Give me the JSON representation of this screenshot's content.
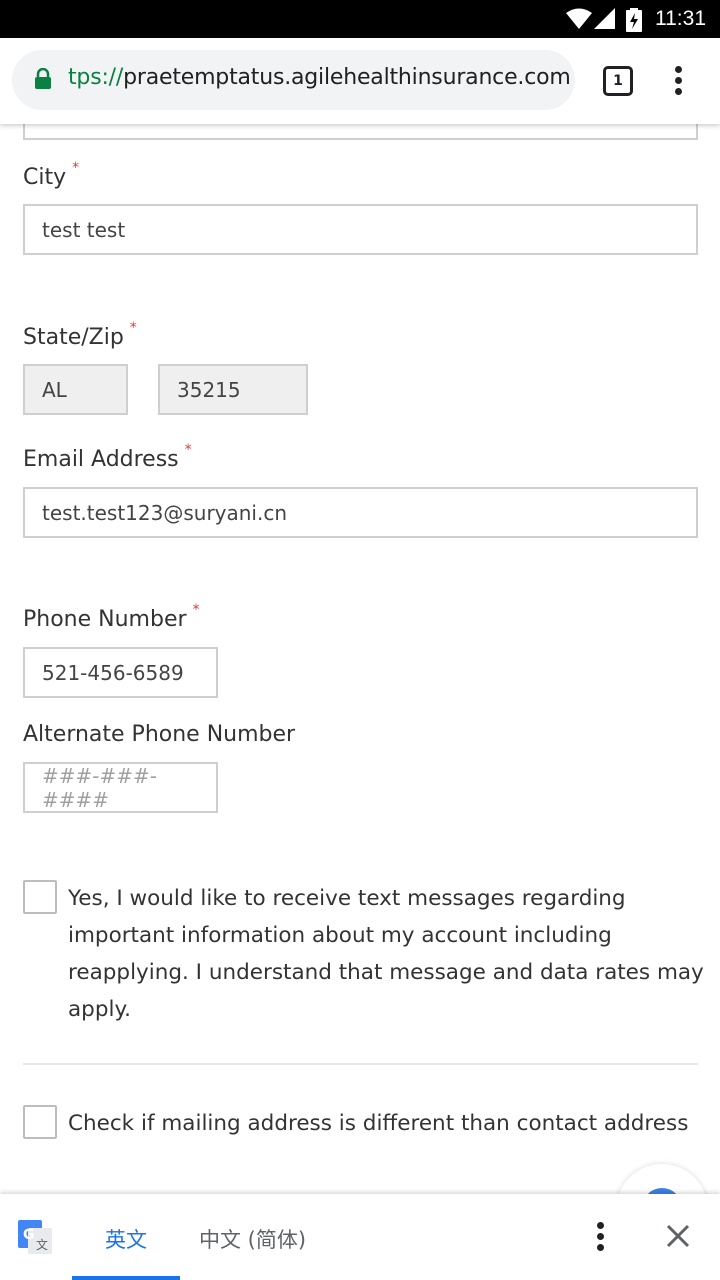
{
  "status_bar": {
    "time": "11:31",
    "icons": [
      "wifi-icon",
      "signal-icon",
      "battery-charging-icon"
    ]
  },
  "browser": {
    "url_scheme": "tps://",
    "url_host": "praetemptatus.agilehealthinsurance.com",
    "tab_count": "1",
    "icons": [
      "lock-icon",
      "more-vert-icon"
    ]
  },
  "form": {
    "city": {
      "label": "City",
      "required_mark": "*",
      "value": "test test"
    },
    "state_zip": {
      "label": "State/Zip",
      "required_mark": "*",
      "state": "AL",
      "zip": "35215"
    },
    "email": {
      "label": "Email Address",
      "required_mark": "*",
      "value": "test.test123@suryani.cn"
    },
    "phone": {
      "label": "Phone Number",
      "required_mark": "*",
      "value": "521-456-6589"
    },
    "alt_phone": {
      "label": "Alternate Phone Number",
      "placeholder": "###-###-####"
    },
    "sms_consent": {
      "checked": false,
      "lines": [
        "Yes, I would like to receive text messages regarding",
        "important information about my account including",
        "reapplying. I understand that message and data rates may",
        "apply."
      ]
    },
    "mailing_diff": {
      "checked": false,
      "text": "Check if mailing address is different than contact address"
    }
  },
  "translate_bar": {
    "source_lang": "英文",
    "target_lang": "中文 (简体)",
    "active": "source",
    "accent_color": "#1a73e8",
    "icons": [
      "google-translate-icon",
      "more-vert-icon",
      "close-icon"
    ]
  }
}
